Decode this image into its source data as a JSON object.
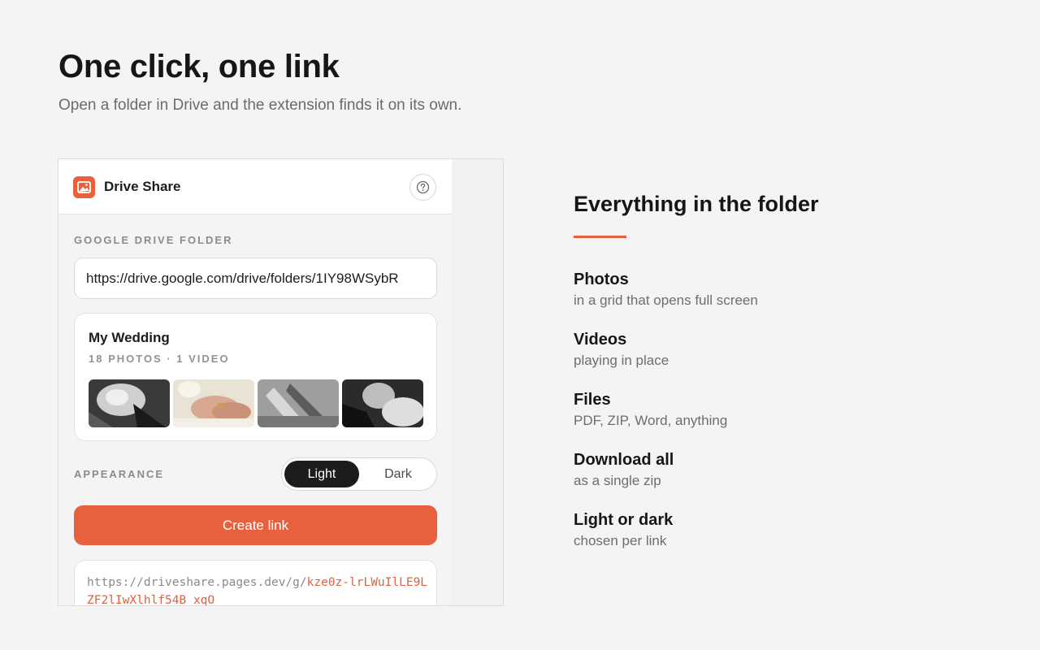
{
  "hero": {
    "title": "One click, one link",
    "subtitle": "Open a folder in Drive and the extension finds it on its own."
  },
  "popup": {
    "app_name": "Drive Share",
    "logo_icon": "image-icon",
    "help_icon": "question-circle-icon",
    "folder_section_label": "GOOGLE DRIVE FOLDER",
    "folder_url_value": "https://drive.google.com/drive/folders/1IY98WSybR",
    "folder_card": {
      "name": "My Wedding",
      "meta": "18 PHOTOS · 1 VIDEO",
      "thumbnails": [
        "bouquet-photo",
        "rings-hands-photo",
        "shoes-photo",
        "couple-photo"
      ]
    },
    "appearance_label": "APPEARANCE",
    "appearance_options": [
      "Light",
      "Dark"
    ],
    "appearance_selected": "Light",
    "create_button": "Create link",
    "result_link_base": "https://driveshare.pages.dev/g/",
    "result_link_id": "kze0z-lrLWuIlLE9LZF2lIwXlhlf54B_xqO"
  },
  "features": {
    "title": "Everything in the folder",
    "accent_color": "#e4603c",
    "items": [
      {
        "name": "Photos",
        "desc": "in a grid that opens full screen"
      },
      {
        "name": "Videos",
        "desc": "playing in place"
      },
      {
        "name": "Files",
        "desc": "PDF, ZIP, Word, anything"
      },
      {
        "name": "Download all",
        "desc": "as a single zip"
      },
      {
        "name": "Light or dark",
        "desc": "chosen per link"
      }
    ]
  }
}
